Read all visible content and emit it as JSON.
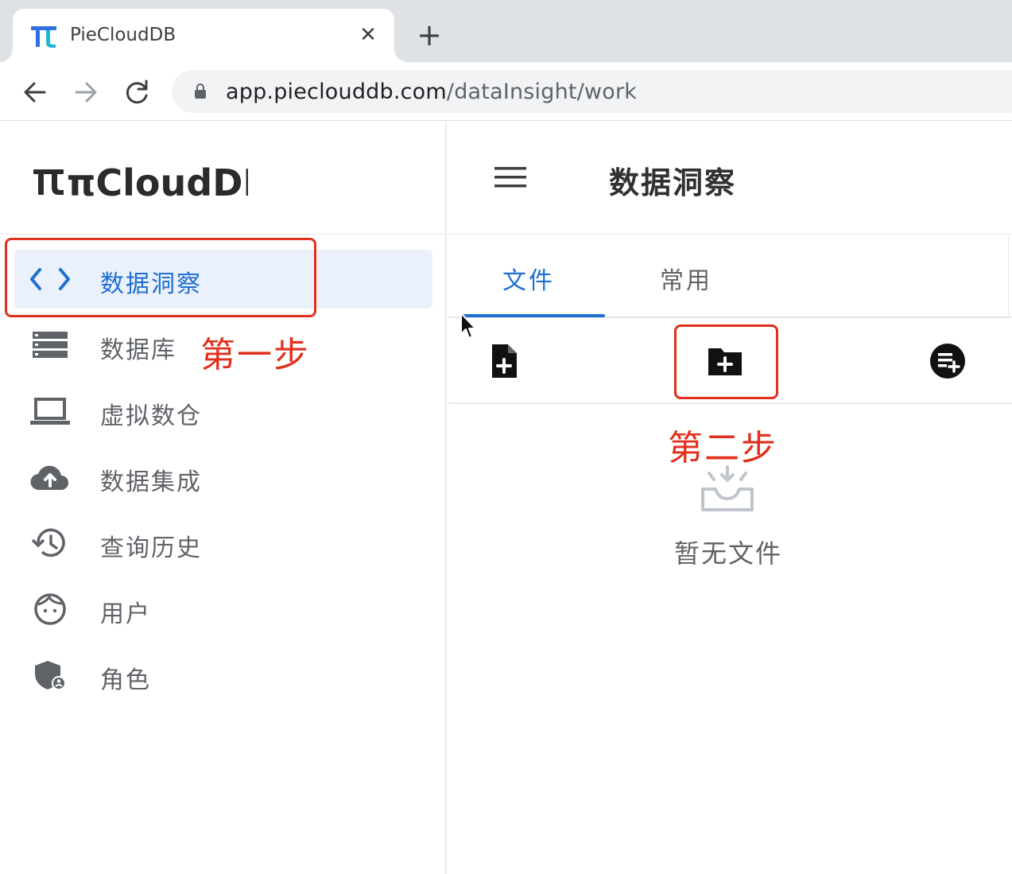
{
  "browser": {
    "tab_title": "PieCloudDB",
    "url_host": "app.pieclouddb.com",
    "url_path": "/dataInsight/work"
  },
  "sidebar": {
    "logo_text": "πCloudDB",
    "items": [
      {
        "label": "数据洞察",
        "icon": "code-icon",
        "active": true
      },
      {
        "label": "数据库",
        "icon": "database-icon",
        "active": false
      },
      {
        "label": "虚拟数仓",
        "icon": "laptop-icon",
        "active": false
      },
      {
        "label": "数据集成",
        "icon": "cloud-upload-icon",
        "active": false
      },
      {
        "label": "查询历史",
        "icon": "history-icon",
        "active": false
      },
      {
        "label": "用户",
        "icon": "user-face-icon",
        "active": false
      },
      {
        "label": "角色",
        "icon": "shield-user-icon",
        "active": false
      }
    ]
  },
  "main": {
    "title": "数据洞察",
    "tabs": [
      {
        "label": "文件",
        "active": true
      },
      {
        "label": "常用",
        "active": false
      }
    ],
    "actions": [
      "new-file-icon",
      "new-folder-icon",
      "new-query-icon"
    ],
    "empty_text": "暂无文件"
  },
  "annotations": {
    "step1": "第一步",
    "step2": "第二步"
  },
  "colors": {
    "accent": "#1f6fd1",
    "annotation": "#e0301e",
    "active_bg": "#eaf1fb"
  }
}
